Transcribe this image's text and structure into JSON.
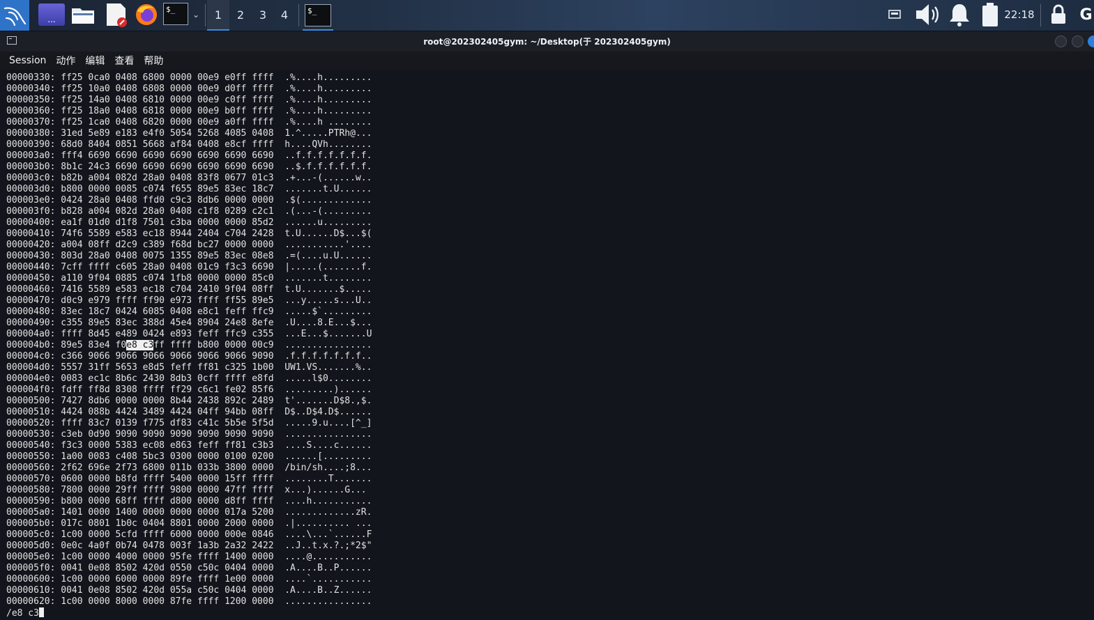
{
  "taskbar": {
    "apps": [
      {
        "name": "kali-menu",
        "icon": "kali-dragon-icon"
      },
      {
        "name": "show-desktop",
        "icon": "desktop-icon",
        "label": "..."
      },
      {
        "name": "file-manager",
        "icon": "folder-icon"
      },
      {
        "name": "text-editor",
        "icon": "text-editor-icon"
      },
      {
        "name": "firefox",
        "icon": "firefox-icon"
      },
      {
        "name": "terminal",
        "icon": "terminal-icon",
        "label": "$_"
      }
    ],
    "workspaces": [
      "1",
      "2",
      "3",
      "4"
    ],
    "active_workspace": "1",
    "task_terminal_label": "$_",
    "clock": "22:18"
  },
  "window": {
    "title": "root@202302405gym: ~/Desktop(于 202302405gym)"
  },
  "menubar": {
    "items": [
      "Session",
      "动作",
      "编辑",
      "查看",
      "帮助"
    ]
  },
  "terminal": {
    "rows": [
      {
        "addr": "00000330:",
        "hex": "ff25 0ca0 0408 6800 0000 00e9 e0ff ffff",
        "ascii": ".%....h........."
      },
      {
        "addr": "00000340:",
        "hex": "ff25 10a0 0408 6808 0000 00e9 d0ff ffff",
        "ascii": ".%....h........."
      },
      {
        "addr": "00000350:",
        "hex": "ff25 14a0 0408 6810 0000 00e9 c0ff ffff",
        "ascii": ".%....h........."
      },
      {
        "addr": "00000360:",
        "hex": "ff25 18a0 0408 6818 0000 00e9 b0ff ffff",
        "ascii": ".%....h........."
      },
      {
        "addr": "00000370:",
        "hex": "ff25 1ca0 0408 6820 0000 00e9 a0ff ffff",
        "ascii": ".%....h ........"
      },
      {
        "addr": "00000380:",
        "hex": "31ed 5e89 e183 e4f0 5054 5268 4085 0408",
        "ascii": "1.^.....PTRh@..."
      },
      {
        "addr": "00000390:",
        "hex": "68d0 8404 0851 5668 af84 0408 e8cf ffff",
        "ascii": "h....QVh........"
      },
      {
        "addr": "000003a0:",
        "hex": "fff4 6690 6690 6690 6690 6690 6690 6690",
        "ascii": "..f.f.f.f.f.f.f."
      },
      {
        "addr": "000003b0:",
        "hex": "8b1c 24c3 6690 6690 6690 6690 6690 6690",
        "ascii": "..$.f.f.f.f.f.f."
      },
      {
        "addr": "000003c0:",
        "hex": "b82b a004 082d 28a0 0408 83f8 0677 01c3",
        "ascii": ".+...-(......w.."
      },
      {
        "addr": "000003d0:",
        "hex": "b800 0000 0085 c074 f655 89e5 83ec 18c7",
        "ascii": ".......t.U......"
      },
      {
        "addr": "000003e0:",
        "hex": "0424 28a0 0408 ffd0 c9c3 8db6 0000 0000",
        "ascii": ".$(............."
      },
      {
        "addr": "000003f0:",
        "hex": "b828 a004 082d 28a0 0408 c1f8 0289 c2c1",
        "ascii": ".(...-(........."
      },
      {
        "addr": "00000400:",
        "hex": "ea1f 01d0 d1f8 7501 c3ba 0000 0000 85d2",
        "ascii": "......u........."
      },
      {
        "addr": "00000410:",
        "hex": "74f6 5589 e583 ec18 8944 2404 c704 2428",
        "ascii": "t.U......D$...$("
      },
      {
        "addr": "00000420:",
        "hex": "a004 08ff d2c9 c389 f68d bc27 0000 0000",
        "ascii": "...........'...."
      },
      {
        "addr": "00000430:",
        "hex": "803d 28a0 0408 0075 1355 89e5 83ec 08e8",
        "ascii": ".=(....u.U......"
      },
      {
        "addr": "00000440:",
        "hex": "7cff ffff c605 28a0 0408 01c9 f3c3 6690",
        "ascii": "|.....(.......f."
      },
      {
        "addr": "00000450:",
        "hex": "a110 9f04 0885 c074 1fb8 0000 0000 85c0",
        "ascii": ".......t........"
      },
      {
        "addr": "00000460:",
        "hex": "7416 5589 e583 ec18 c704 2410 9f04 08ff",
        "ascii": "t.U.......$....."
      },
      {
        "addr": "00000470:",
        "hex": "d0c9 e979 ffff ff90 e973 ffff ff55 89e5",
        "ascii": "...y.....s...U.."
      },
      {
        "addr": "00000480:",
        "hex": "83ec 18c7 0424 6085 0408 e8c1 feff ffc9",
        "ascii": ".....$`........."
      },
      {
        "addr": "00000490:",
        "hex": "c355 89e5 83ec 388d 45e4 8904 24e8 8efe",
        "ascii": ".U....8.E...$..."
      },
      {
        "addr": "000004a0:",
        "hex": "ffff 8d45 e489 0424 e893 feff ffc9 c355",
        "ascii": "...E...$.......U"
      },
      {
        "addr": "000004b0:",
        "hex_pre": "89e5 83e4 f0",
        "hex_hl": "e8 c3",
        "hex_post": "ff ffff b800 0000 00c9",
        "ascii": "................"
      },
      {
        "addr": "000004c0:",
        "hex": "c366 9066 9066 9066 9066 9066 9066 9090",
        "ascii": ".f.f.f.f.f.f.f.."
      },
      {
        "addr": "000004d0:",
        "hex": "5557 31ff 5653 e8d5 feff ff81 c325 1b00",
        "ascii": "UW1.VS.......%.."
      },
      {
        "addr": "000004e0:",
        "hex": "0083 ec1c 8b6c 2430 8db3 0cff ffff e8fd",
        "ascii": ".....l$0........"
      },
      {
        "addr": "000004f0:",
        "hex": "fdff ff8d 8308 ffff ff29 c6c1 fe02 85f6",
        "ascii": ".........)......"
      },
      {
        "addr": "00000500:",
        "hex": "7427 8db6 0000 0000 8b44 2438 892c 2489",
        "ascii": "t'.......D$8.,$."
      },
      {
        "addr": "00000510:",
        "hex": "4424 088b 4424 3489 4424 04ff 94bb 08ff",
        "ascii": "D$..D$4.D$......"
      },
      {
        "addr": "00000520:",
        "hex": "ffff 83c7 0139 f775 df83 c41c 5b5e 5f5d",
        "ascii": ".....9.u....[^_]"
      },
      {
        "addr": "00000530:",
        "hex": "c3eb 0d90 9090 9090 9090 9090 9090 9090",
        "ascii": "................"
      },
      {
        "addr": "00000540:",
        "hex": "f3c3 0000 5383 ec08 e863 feff ff81 c3b3",
        "ascii": "....S....c......"
      },
      {
        "addr": "00000550:",
        "hex": "1a00 0083 c408 5bc3 0300 0000 0100 0200",
        "ascii": "......[........."
      },
      {
        "addr": "00000560:",
        "hex": "2f62 696e 2f73 6800 011b 033b 3800 0000",
        "ascii": "/bin/sh....;8..."
      },
      {
        "addr": "00000570:",
        "hex": "0600 0000 b8fd ffff 5400 0000 15ff ffff",
        "ascii": "........T......."
      },
      {
        "addr": "00000580:",
        "hex": "7800 0000 29ff ffff 9800 0000 47ff ffff",
        "ascii": "x...)......G..."
      },
      {
        "addr": "00000590:",
        "hex": "b800 0000 68ff ffff d800 0000 d8ff ffff",
        "ascii": "....h..........."
      },
      {
        "addr": "000005a0:",
        "hex": "1401 0000 1400 0000 0000 0000 017a 5200",
        "ascii": ".............zR."
      },
      {
        "addr": "000005b0:",
        "hex": "017c 0801 1b0c 0404 8801 0000 2000 0000",
        "ascii": ".|.......... ..."
      },
      {
        "addr": "000005c0:",
        "hex": "1c00 0000 5cfd ffff 6000 0000 000e 0846",
        "ascii": "....\\...`......F"
      },
      {
        "addr": "000005d0:",
        "hex": "0e0c 4a0f 0b74 0478 003f 1a3b 2a32 2422",
        "ascii": "..J..t.x.?.;*2$\""
      },
      {
        "addr": "000005e0:",
        "hex": "1c00 0000 4000 0000 95fe ffff 1400 0000",
        "ascii": "....@..........."
      },
      {
        "addr": "000005f0:",
        "hex": "0041 0e08 8502 420d 0550 c50c 0404 0000",
        "ascii": ".A....B..P......"
      },
      {
        "addr": "00000600:",
        "hex": "1c00 0000 6000 0000 89fe ffff 1e00 0000",
        "ascii": "....`..........."
      },
      {
        "addr": "00000610:",
        "hex": "0041 0e08 8502 420d 055a c50c 0404 0000",
        "ascii": ".A....B..Z......"
      },
      {
        "addr": "00000620:",
        "hex": "1c00 0000 8000 0000 87fe ffff 1200 0000",
        "ascii": "................"
      }
    ],
    "search_prompt": "/e8 c3"
  },
  "colors": {
    "terminal_bg": "#12151b",
    "accent": "#3c8de3",
    "highlight": "#f0f0f0"
  }
}
